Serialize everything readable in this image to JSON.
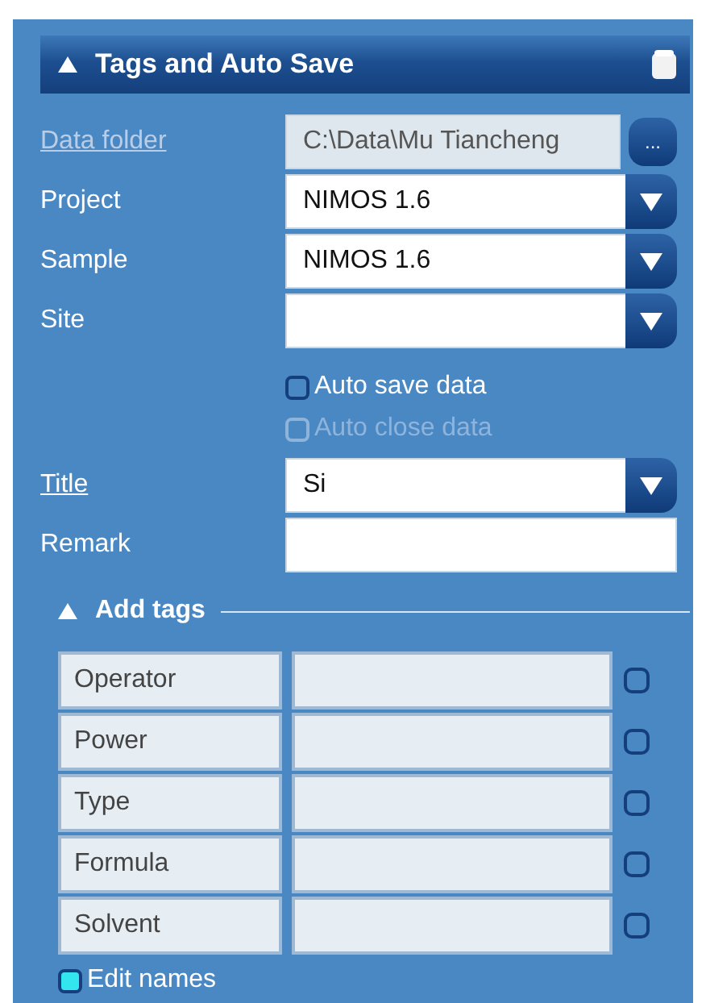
{
  "panel": {
    "title": "Tags and Auto Save",
    "expanded": true
  },
  "fields": [
    {
      "label": "Data folder",
      "link": true,
      "disabled": true,
      "kind": "browse",
      "value": "C:\\Data\\Mu Tiancheng",
      "button": "..."
    },
    {
      "label": "Project",
      "link": false,
      "disabled": false,
      "kind": "dropdown",
      "value": "NIMOS 1.6"
    },
    {
      "label": "Sample",
      "link": false,
      "disabled": false,
      "kind": "dropdown",
      "value": "NIMOS 1.6"
    },
    {
      "label": "Site",
      "link": false,
      "disabled": false,
      "kind": "dropdown"
    }
  ],
  "options": [
    {
      "label": "Auto save data",
      "checked": false,
      "disabled": false
    },
    {
      "label": "Auto close data",
      "checked": false,
      "disabled": true
    }
  ],
  "fields_2": [
    {
      "label": "Title",
      "link": true,
      "disabled": false,
      "kind": "dropdown",
      "value": "Si"
    },
    {
      "label": "Remark",
      "link": false,
      "disabled": false,
      "kind": "text"
    }
  ],
  "add_tags": {
    "title": "Add tags",
    "expanded": true,
    "rows": [
      {
        "name": "Operator",
        "checked": false
      },
      {
        "name": "Power",
        "checked": false
      },
      {
        "name": "Type",
        "checked": false
      },
      {
        "name": "Formula",
        "checked": false
      },
      {
        "name": "Solvent",
        "checked": false
      }
    ],
    "edit_names": {
      "label": "Edit names",
      "checked": true
    }
  }
}
